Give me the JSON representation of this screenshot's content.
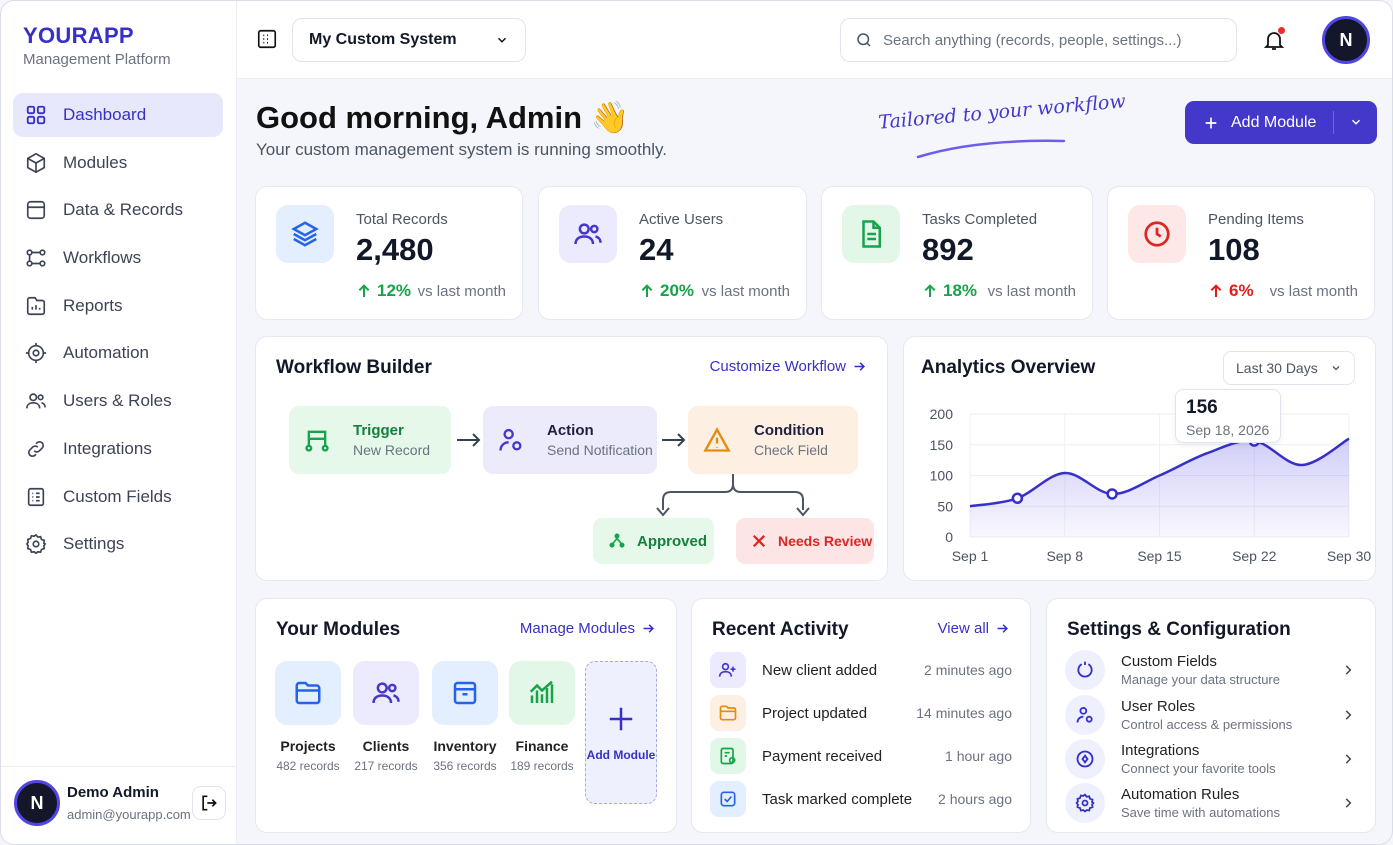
{
  "brand": {
    "name": "YOURAPP",
    "subtitle": "Management Platform"
  },
  "sidebar": {
    "items": [
      {
        "label": "Dashboard",
        "icon": "dashboard-icon",
        "active": true
      },
      {
        "label": "Modules",
        "icon": "cube-icon"
      },
      {
        "label": "Data & Records",
        "icon": "database-icon"
      },
      {
        "label": "Workflows",
        "icon": "workflow-icon"
      },
      {
        "label": "Reports",
        "icon": "reports-icon"
      },
      {
        "label": "Automation",
        "icon": "automation-icon"
      },
      {
        "label": "Users & Roles",
        "icon": "users-icon"
      },
      {
        "label": "Integrations",
        "icon": "link-icon"
      },
      {
        "label": "Custom Fields",
        "icon": "form-icon"
      },
      {
        "label": "Settings",
        "icon": "gear-icon"
      }
    ]
  },
  "profile": {
    "initial": "N",
    "name": "Demo Admin",
    "email": "admin@yourapp.com"
  },
  "topbar": {
    "system": "My Custom System",
    "search_placeholder": "Search anything (records, people, settings...)",
    "avatar_initial": "N"
  },
  "header": {
    "greeting": "Good morning, Admin 👋",
    "subtitle": "Your custom management system is running smoothly.",
    "tagline": "Tailored to your workflow",
    "add_module": "Add Module"
  },
  "colors": {
    "accent": "#4338ca",
    "up": "#16a34a",
    "down": "#e11d1d"
  },
  "stats": [
    {
      "label": "Total Records",
      "value": "2,480",
      "change": "12%",
      "direction": "up",
      "vs": "vs last month",
      "icon": "layers-icon"
    },
    {
      "label": "Active Users",
      "value": "24",
      "change": "20%",
      "direction": "up",
      "vs": "vs last month",
      "icon": "users-icon"
    },
    {
      "label": "Tasks Completed",
      "value": "892",
      "change": "18%",
      "direction": "up",
      "vs": "vs last month",
      "icon": "document-icon"
    },
    {
      "label": "Pending Items",
      "value": "108",
      "change": "6%",
      "direction": "down",
      "vs": "vs last month",
      "icon": "clock-icon"
    }
  ],
  "workflow": {
    "title": "Workflow Builder",
    "link": "Customize Workflow",
    "trigger": {
      "title": "Trigger",
      "sub": "New Record"
    },
    "action": {
      "title": "Action",
      "sub": "Send Notification"
    },
    "condition": {
      "title": "Condition",
      "sub": "Check Field"
    },
    "approved": "Approved",
    "review": "Needs Review"
  },
  "analytics": {
    "title": "Analytics Overview",
    "range": "Last 30 Days",
    "tooltip": {
      "value": "156",
      "date": "Sep 18, 2026"
    }
  },
  "chart_data": {
    "type": "line",
    "x": [
      "Sep 1",
      "Sep 4",
      "Sep 8",
      "Sep 12",
      "Sep 15",
      "Sep 18",
      "Sep 22",
      "Sep 26",
      "Sep 30"
    ],
    "xticks": [
      "Sep 1",
      "Sep 8",
      "Sep 15",
      "Sep 22",
      "Sep 30"
    ],
    "values": [
      50,
      63,
      104,
      70,
      100,
      136,
      156,
      117,
      160
    ],
    "markers": [
      1,
      3,
      6
    ],
    "yticks": [
      0,
      50,
      100,
      150,
      200
    ],
    "ylim": [
      0,
      200
    ],
    "grid": true
  },
  "modules": {
    "title": "Your Modules",
    "link": "Manage Modules",
    "items": [
      {
        "name": "Projects",
        "count": "482 records",
        "icon": "folder-icon"
      },
      {
        "name": "Clients",
        "count": "217 records",
        "icon": "users-icon"
      },
      {
        "name": "Inventory",
        "count": "356 records",
        "icon": "box-icon"
      },
      {
        "name": "Finance",
        "count": "189 records",
        "icon": "chart-icon"
      }
    ],
    "add_label": "Add Module"
  },
  "activity": {
    "title": "Recent Activity",
    "link": "View all",
    "items": [
      {
        "text": "New client added",
        "time": "2 minutes ago",
        "icon": "user-plus-icon"
      },
      {
        "text": "Project updated",
        "time": "14 minutes ago",
        "icon": "folder-icon"
      },
      {
        "text": "Payment received",
        "time": "1 hour ago",
        "icon": "payment-icon"
      },
      {
        "text": "Task marked complete",
        "time": "2 hours ago",
        "icon": "check-square-icon"
      }
    ]
  },
  "settings": {
    "title": "Settings & Configuration",
    "items": [
      {
        "title": "Custom Fields",
        "sub": "Manage your data structure",
        "icon": "power-icon"
      },
      {
        "title": "User Roles",
        "sub": "Control access & permissions",
        "icon": "user-roles-icon"
      },
      {
        "title": "Integrations",
        "sub": "Connect your favorite tools",
        "icon": "integration-icon"
      },
      {
        "title": "Automation Rules",
        "sub": "Save time with automations",
        "icon": "gear-icon"
      }
    ]
  }
}
